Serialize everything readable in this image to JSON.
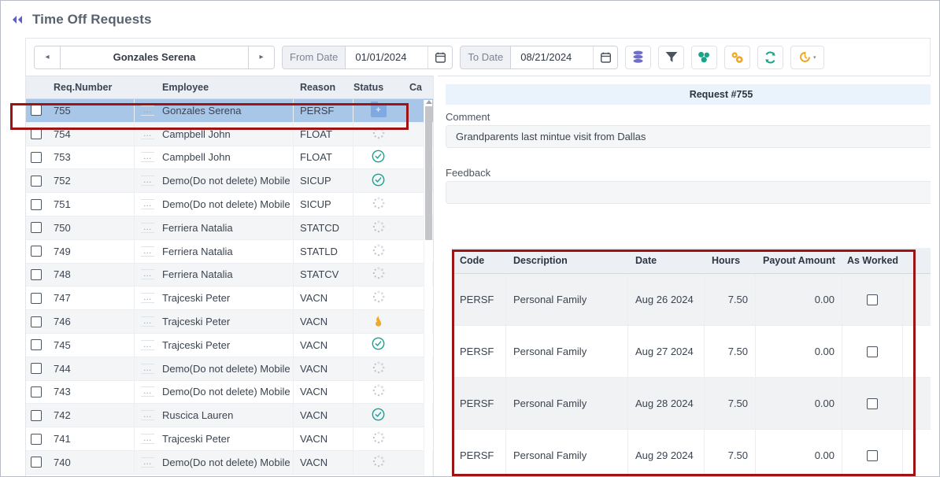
{
  "header": {
    "collapse_icon": "collapse-left-icon",
    "title": "Time Off Requests"
  },
  "toolbar": {
    "prev_label": "◂",
    "employee_name": "Gonzales Serena",
    "next_label": "▸",
    "from_date_label": "From Date",
    "from_date_value": "01/01/2024",
    "to_date_label": "To Date",
    "to_date_value": "08/21/2024",
    "buttons": [
      {
        "name": "database-icon",
        "color": "#6f6fc9"
      },
      {
        "name": "filter-icon",
        "color": "#4b5360"
      },
      {
        "name": "cubes-icon",
        "color": "#17a589"
      },
      {
        "name": "gears-icon",
        "color": "#f0a824"
      },
      {
        "name": "refresh-icon",
        "color": "#17a589"
      },
      {
        "name": "history-icon",
        "color": "#f0a824"
      }
    ],
    "history_caret": "▾"
  },
  "left_grid": {
    "columns": [
      "",
      "Req.Number",
      "",
      "Employee",
      "Reason",
      "Status",
      "Ca"
    ],
    "rows": [
      {
        "num": "755",
        "employee": "Gonzales Serena",
        "reason": "PERSF",
        "status": "folder-add",
        "selected": true
      },
      {
        "num": "754",
        "employee": "Campbell John",
        "reason": "FLOAT",
        "status": "pending"
      },
      {
        "num": "753",
        "employee": "Campbell John",
        "reason": "FLOAT",
        "status": "approved"
      },
      {
        "num": "752",
        "employee": "Demo(Do not delete) Mobile",
        "reason": "SICUP",
        "status": "approved"
      },
      {
        "num": "751",
        "employee": "Demo(Do not delete) Mobile",
        "reason": "SICUP",
        "status": "pending"
      },
      {
        "num": "750",
        "employee": "Ferriera Natalia",
        "reason": "STATCD",
        "status": "pending"
      },
      {
        "num": "749",
        "employee": "Ferriera Natalia",
        "reason": "STATLD",
        "status": "pending"
      },
      {
        "num": "748",
        "employee": "Ferriera Natalia",
        "reason": "STATCV",
        "status": "pending"
      },
      {
        "num": "747",
        "employee": "Trajceski Peter",
        "reason": "VACN",
        "status": "pending"
      },
      {
        "num": "746",
        "employee": "Trajceski Peter",
        "reason": "VACN",
        "status": "flame"
      },
      {
        "num": "745",
        "employee": "Trajceski Peter",
        "reason": "VACN",
        "status": "approved"
      },
      {
        "num": "744",
        "employee": "Demo(Do not delete) Mobile",
        "reason": "VACN",
        "status": "pending"
      },
      {
        "num": "743",
        "employee": "Demo(Do not delete) Mobile",
        "reason": "VACN",
        "status": "pending"
      },
      {
        "num": "742",
        "employee": "Ruscica Lauren",
        "reason": "VACN",
        "status": "approved"
      },
      {
        "num": "741",
        "employee": "Trajceski Peter",
        "reason": "VACN",
        "status": "pending"
      },
      {
        "num": "740",
        "employee": "Demo(Do not delete) Mobile",
        "reason": "VACN",
        "status": "pending"
      }
    ],
    "row_menu_label": "…"
  },
  "detail": {
    "request_title": "Request #755",
    "comment_label": "Comment",
    "comment_value": "Grandparents last mintue visit from Dallas",
    "feedback_label": "Feedback",
    "feedback_value": "",
    "table": {
      "columns": [
        "Code",
        "Description",
        "Date",
        "Hours",
        "Payout Amount",
        "As Worked"
      ],
      "rows": [
        {
          "code": "PERSF",
          "description": "Personal Family",
          "date": "Aug 26 2024",
          "hours": "7.50",
          "payout": "0.00",
          "as_worked": false
        },
        {
          "code": "PERSF",
          "description": "Personal Family",
          "date": "Aug 27 2024",
          "hours": "7.50",
          "payout": "0.00",
          "as_worked": false
        },
        {
          "code": "PERSF",
          "description": "Personal Family",
          "date": "Aug 28 2024",
          "hours": "7.50",
          "payout": "0.00",
          "as_worked": false
        },
        {
          "code": "PERSF",
          "description": "Personal Family",
          "date": "Aug 29 2024",
          "hours": "7.50",
          "payout": "0.00",
          "as_worked": false
        }
      ]
    }
  },
  "annotations": {
    "highlight_color": "#9e1414"
  }
}
